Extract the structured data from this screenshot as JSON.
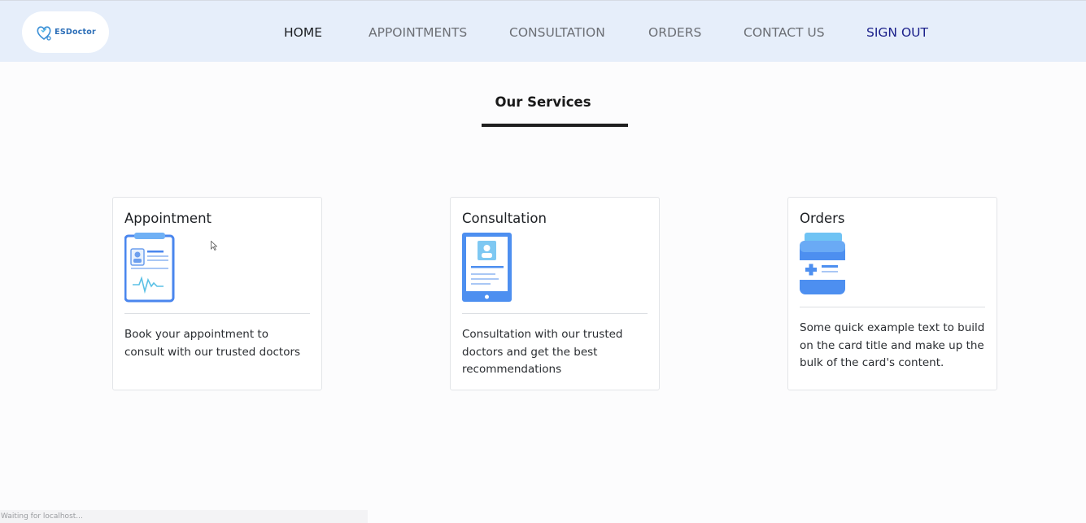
{
  "brand": {
    "logo_text": "ESDoctor"
  },
  "nav": {
    "home": "HOME",
    "appointments": "APPOINTMENTS",
    "consultation": "CONSULTATION",
    "orders": "ORDERS",
    "contact": "CONTACT US",
    "signout": "SIGN OUT"
  },
  "services": {
    "title": "Our Services",
    "cards": [
      {
        "title": "Appointment",
        "icon": "clipboard-medical-icon",
        "text": "Book your appointment to consult with our trusted doctors"
      },
      {
        "title": "Consultation",
        "icon": "tablet-profile-icon",
        "text": "Consultation with our trusted doctors and get the best recommendations"
      },
      {
        "title": "Orders",
        "icon": "medicine-bottle-icon",
        "text": "Some quick example text to build on the card title and make up the bulk of the card's content."
      }
    ]
  },
  "status_bar": {
    "text": "Waiting for localhost..."
  },
  "colors": {
    "navbar_bg": "#e6eefa",
    "signout": "#1a1f8a",
    "icon_blue": "#4a8ff0"
  }
}
